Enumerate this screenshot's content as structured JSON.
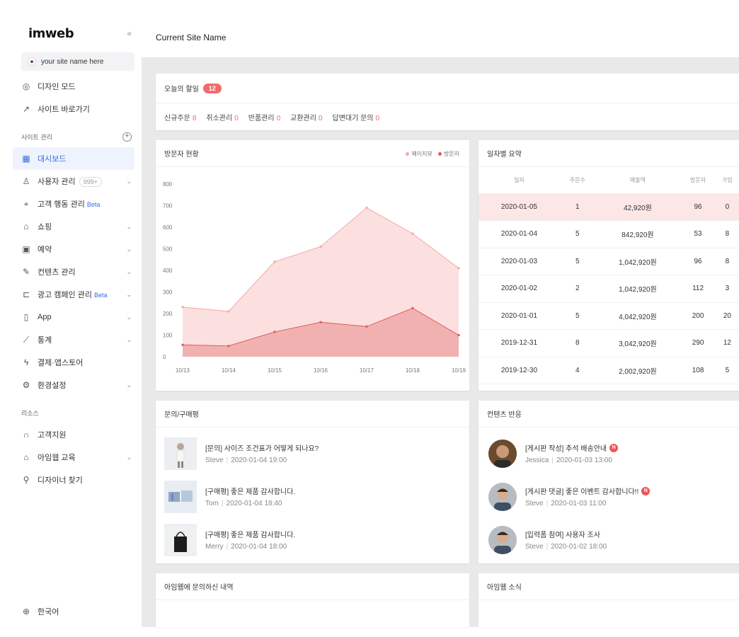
{
  "sidebar": {
    "logo": "imweb",
    "collapse_icon": "«",
    "site_name": "your site name here",
    "top_items": [
      {
        "label": "디자인 모드",
        "icon": "palette-icon"
      },
      {
        "label": "사이트 바로가기",
        "icon": "external-link-icon"
      }
    ],
    "section_site": "사이트 관리",
    "nav": [
      {
        "label": "대시보드",
        "icon": "dashboard-icon",
        "active": true
      },
      {
        "label": "사용자 관리",
        "icon": "users-icon",
        "count": "999+",
        "chevron": true
      },
      {
        "label": "고객 행동 관리",
        "icon": "target-icon",
        "beta": "Beta"
      },
      {
        "label": "쇼핑",
        "icon": "shopping-bag-icon",
        "chevron": true
      },
      {
        "label": "예약",
        "icon": "calendar-icon",
        "chevron": true
      },
      {
        "label": "컨텐츠 관리",
        "icon": "edit-icon",
        "chevron": true
      },
      {
        "label": "광고 캠페인 관리",
        "icon": "megaphone-icon",
        "beta": "Beta",
        "chevron": true
      },
      {
        "label": "App",
        "icon": "mobile-icon",
        "chevron": true
      },
      {
        "label": "통계",
        "icon": "chart-icon",
        "chevron": true
      },
      {
        "label": "결제·앱스토어",
        "icon": "lightning-icon"
      },
      {
        "label": "환경설정",
        "icon": "settings-icon",
        "chevron": true
      }
    ],
    "section_resource": "리소스",
    "resources": [
      {
        "label": "고객지원",
        "icon": "headset-icon"
      },
      {
        "label": "아임웹 교육",
        "icon": "graduation-icon",
        "chevron": true
      },
      {
        "label": "디자이너 찾기",
        "icon": "search-icon"
      }
    ],
    "language": "한국어"
  },
  "topbar": {
    "title": "Current Site Name"
  },
  "todo": {
    "title": "오늘의 할일",
    "badge": "12",
    "stats": [
      {
        "label": "신규주문",
        "value": "8"
      },
      {
        "label": "취소관리",
        "value": "0"
      },
      {
        "label": "반품관리",
        "value": "0"
      },
      {
        "label": "교환관리",
        "value": "0"
      },
      {
        "label": "답변대기 문의",
        "value": "0"
      }
    ]
  },
  "visitors": {
    "title": "방문자 현황",
    "legend": [
      "페이지뷰",
      "방문자"
    ],
    "colors": {
      "pageview": "#f7a6a6",
      "visitor": "#e05a5a"
    }
  },
  "chart_data": {
    "type": "area",
    "categories": [
      "10/13",
      "10/14",
      "10/15",
      "10/16",
      "10/17",
      "10/18",
      "10/19"
    ],
    "series": [
      {
        "name": "페이지뷰",
        "values": [
          230,
          210,
          440,
          510,
          690,
          570,
          410
        ]
      },
      {
        "name": "방문자",
        "values": [
          55,
          50,
          115,
          160,
          140,
          225,
          100
        ]
      }
    ],
    "yticks": [
      0,
      100,
      200,
      300,
      400,
      500,
      600,
      700,
      800
    ],
    "ylim": [
      0,
      800
    ],
    "grid": false,
    "legend_position": "top-right"
  },
  "daily": {
    "title": "일자별 요약",
    "columns": [
      "일자",
      "주문수",
      "매출액",
      "방문자",
      "가입"
    ],
    "rows": [
      [
        "2020-01-05",
        "1",
        "42,920원",
        "96",
        "0"
      ],
      [
        "2020-01-04",
        "5",
        "842,920원",
        "53",
        "8"
      ],
      [
        "2020-01-03",
        "5",
        "1,042,920원",
        "96",
        "8"
      ],
      [
        "2020-01-02",
        "2",
        "1,042,920원",
        "112",
        "3"
      ],
      [
        "2020-01-01",
        "5",
        "4,042,920원",
        "200",
        "20"
      ],
      [
        "2019-12-31",
        "8",
        "3,042,920원",
        "290",
        "12"
      ],
      [
        "2019-12-30",
        "4",
        "2,002,920원",
        "108",
        "5"
      ]
    ]
  },
  "inquiries": {
    "title": "문의/구매평",
    "items": [
      {
        "title": "[문의] 사이즈 조건표가 어떻게 되나요?",
        "user": "Steve",
        "date": "2020-01-04 19:00"
      },
      {
        "title": "[구매평] 좋은 제품 감사합니다.",
        "user": "Tom",
        "date": "2020-01-04 18:40"
      },
      {
        "title": "[구매평] 좋은 제품 감사합니다.",
        "user": "Merry",
        "date": "2020-01-04 18:00"
      }
    ]
  },
  "content_react": {
    "title": "컨텐츠 반응",
    "new_badge": "N",
    "items": [
      {
        "title": "[게시판 작성] 추석 배송안내",
        "user": "Jessica",
        "date": "2020-01-03 13:00",
        "is_new": true
      },
      {
        "title": "[게시판 댓글] 좋은 이벤트 감사합니다!!",
        "user": "Steve",
        "date": "2020-01-03 11:00",
        "is_new": true
      },
      {
        "title": "[입력폼 참여] 사용자 조사",
        "user": "Steve",
        "date": "2020-01-02 18:00",
        "is_new": false
      }
    ]
  },
  "imweb_inquiries": {
    "title": "아임웹에 문의하신 내역"
  },
  "imweb_news": {
    "title": "아임웹 소식"
  }
}
